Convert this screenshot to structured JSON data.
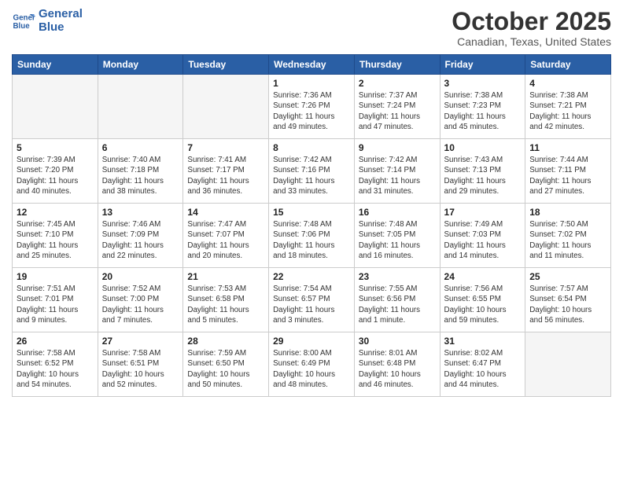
{
  "logo": {
    "line1": "General",
    "line2": "Blue"
  },
  "title": "October 2025",
  "location": "Canadian, Texas, United States",
  "weekdays": [
    "Sunday",
    "Monday",
    "Tuesday",
    "Wednesday",
    "Thursday",
    "Friday",
    "Saturday"
  ],
  "weeks": [
    [
      {
        "day": "",
        "info": ""
      },
      {
        "day": "",
        "info": ""
      },
      {
        "day": "",
        "info": ""
      },
      {
        "day": "1",
        "info": "Sunrise: 7:36 AM\nSunset: 7:26 PM\nDaylight: 11 hours\nand 49 minutes."
      },
      {
        "day": "2",
        "info": "Sunrise: 7:37 AM\nSunset: 7:24 PM\nDaylight: 11 hours\nand 47 minutes."
      },
      {
        "day": "3",
        "info": "Sunrise: 7:38 AM\nSunset: 7:23 PM\nDaylight: 11 hours\nand 45 minutes."
      },
      {
        "day": "4",
        "info": "Sunrise: 7:38 AM\nSunset: 7:21 PM\nDaylight: 11 hours\nand 42 minutes."
      }
    ],
    [
      {
        "day": "5",
        "info": "Sunrise: 7:39 AM\nSunset: 7:20 PM\nDaylight: 11 hours\nand 40 minutes."
      },
      {
        "day": "6",
        "info": "Sunrise: 7:40 AM\nSunset: 7:18 PM\nDaylight: 11 hours\nand 38 minutes."
      },
      {
        "day": "7",
        "info": "Sunrise: 7:41 AM\nSunset: 7:17 PM\nDaylight: 11 hours\nand 36 minutes."
      },
      {
        "day": "8",
        "info": "Sunrise: 7:42 AM\nSunset: 7:16 PM\nDaylight: 11 hours\nand 33 minutes."
      },
      {
        "day": "9",
        "info": "Sunrise: 7:42 AM\nSunset: 7:14 PM\nDaylight: 11 hours\nand 31 minutes."
      },
      {
        "day": "10",
        "info": "Sunrise: 7:43 AM\nSunset: 7:13 PM\nDaylight: 11 hours\nand 29 minutes."
      },
      {
        "day": "11",
        "info": "Sunrise: 7:44 AM\nSunset: 7:11 PM\nDaylight: 11 hours\nand 27 minutes."
      }
    ],
    [
      {
        "day": "12",
        "info": "Sunrise: 7:45 AM\nSunset: 7:10 PM\nDaylight: 11 hours\nand 25 minutes."
      },
      {
        "day": "13",
        "info": "Sunrise: 7:46 AM\nSunset: 7:09 PM\nDaylight: 11 hours\nand 22 minutes."
      },
      {
        "day": "14",
        "info": "Sunrise: 7:47 AM\nSunset: 7:07 PM\nDaylight: 11 hours\nand 20 minutes."
      },
      {
        "day": "15",
        "info": "Sunrise: 7:48 AM\nSunset: 7:06 PM\nDaylight: 11 hours\nand 18 minutes."
      },
      {
        "day": "16",
        "info": "Sunrise: 7:48 AM\nSunset: 7:05 PM\nDaylight: 11 hours\nand 16 minutes."
      },
      {
        "day": "17",
        "info": "Sunrise: 7:49 AM\nSunset: 7:03 PM\nDaylight: 11 hours\nand 14 minutes."
      },
      {
        "day": "18",
        "info": "Sunrise: 7:50 AM\nSunset: 7:02 PM\nDaylight: 11 hours\nand 11 minutes."
      }
    ],
    [
      {
        "day": "19",
        "info": "Sunrise: 7:51 AM\nSunset: 7:01 PM\nDaylight: 11 hours\nand 9 minutes."
      },
      {
        "day": "20",
        "info": "Sunrise: 7:52 AM\nSunset: 7:00 PM\nDaylight: 11 hours\nand 7 minutes."
      },
      {
        "day": "21",
        "info": "Sunrise: 7:53 AM\nSunset: 6:58 PM\nDaylight: 11 hours\nand 5 minutes."
      },
      {
        "day": "22",
        "info": "Sunrise: 7:54 AM\nSunset: 6:57 PM\nDaylight: 11 hours\nand 3 minutes."
      },
      {
        "day": "23",
        "info": "Sunrise: 7:55 AM\nSunset: 6:56 PM\nDaylight: 11 hours\nand 1 minute."
      },
      {
        "day": "24",
        "info": "Sunrise: 7:56 AM\nSunset: 6:55 PM\nDaylight: 10 hours\nand 59 minutes."
      },
      {
        "day": "25",
        "info": "Sunrise: 7:57 AM\nSunset: 6:54 PM\nDaylight: 10 hours\nand 56 minutes."
      }
    ],
    [
      {
        "day": "26",
        "info": "Sunrise: 7:58 AM\nSunset: 6:52 PM\nDaylight: 10 hours\nand 54 minutes."
      },
      {
        "day": "27",
        "info": "Sunrise: 7:58 AM\nSunset: 6:51 PM\nDaylight: 10 hours\nand 52 minutes."
      },
      {
        "day": "28",
        "info": "Sunrise: 7:59 AM\nSunset: 6:50 PM\nDaylight: 10 hours\nand 50 minutes."
      },
      {
        "day": "29",
        "info": "Sunrise: 8:00 AM\nSunset: 6:49 PM\nDaylight: 10 hours\nand 48 minutes."
      },
      {
        "day": "30",
        "info": "Sunrise: 8:01 AM\nSunset: 6:48 PM\nDaylight: 10 hours\nand 46 minutes."
      },
      {
        "day": "31",
        "info": "Sunrise: 8:02 AM\nSunset: 6:47 PM\nDaylight: 10 hours\nand 44 minutes."
      },
      {
        "day": "",
        "info": ""
      }
    ]
  ]
}
